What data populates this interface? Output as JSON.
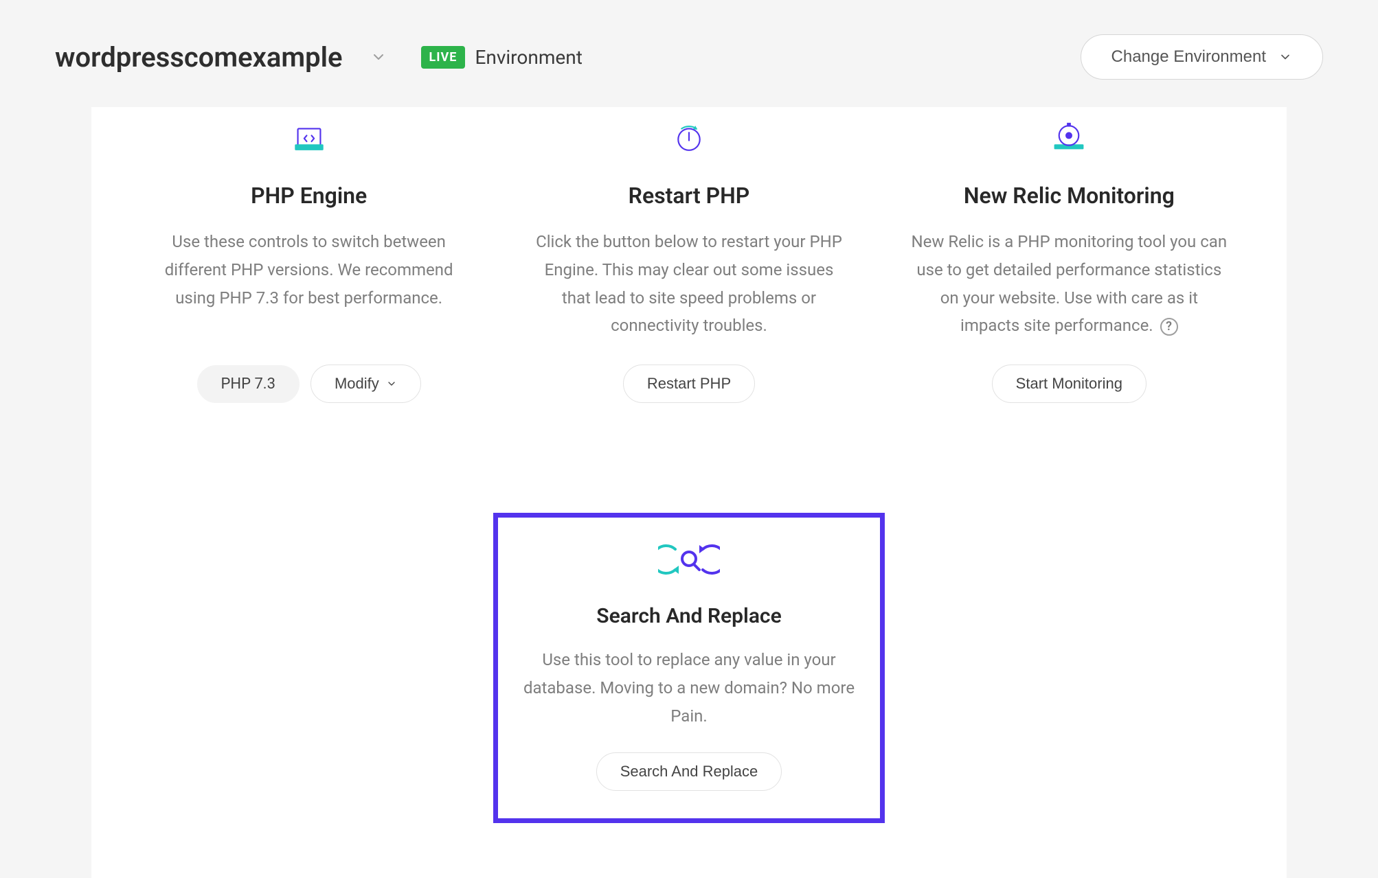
{
  "header": {
    "site_name": "wordpresscomexample",
    "live_badge": "LIVE",
    "environment_label": "Environment",
    "change_env_button": "Change Environment"
  },
  "cards": {
    "php_engine": {
      "title": "PHP Engine",
      "description": "Use these controls to switch between different PHP versions. We recommend using PHP 7.3 for best performance.",
      "version_pill": "PHP 7.3",
      "modify_button": "Modify"
    },
    "restart_php": {
      "title": "Restart PHP",
      "description": "Click the button below to restart your PHP Engine. This may clear out some issues that lead to site speed problems or connectivity troubles.",
      "button": "Restart PHP"
    },
    "new_relic": {
      "title": "New Relic Monitoring",
      "description": "New Relic is a PHP monitoring tool you can use to get detailed performance statistics on your website. Use with care as it impacts site performance.",
      "button": "Start Monitoring"
    },
    "search_replace": {
      "title": "Search And Replace",
      "description": "Use this tool to replace any value in your database. Moving to a new domain? No more Pain.",
      "button": "Search And Replace"
    }
  }
}
